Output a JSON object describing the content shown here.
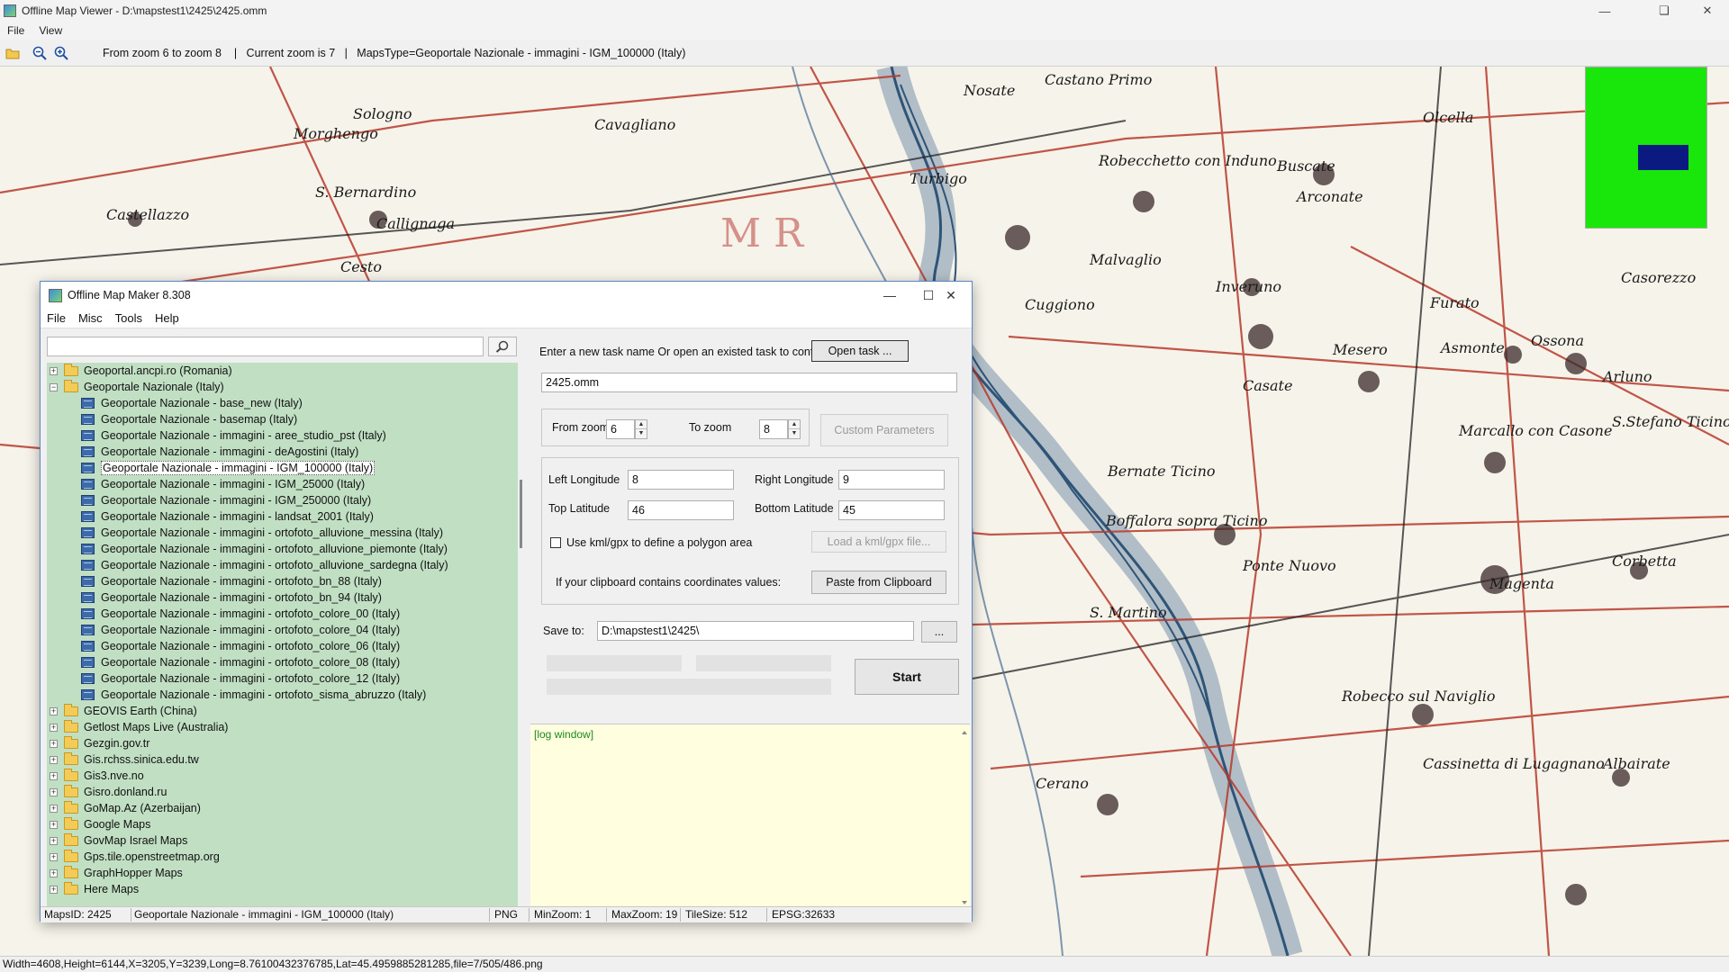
{
  "viewer": {
    "title": "Offline Map Viewer - D:\\mapstest1\\2425\\2425.omm",
    "menu": [
      "File",
      "View"
    ],
    "toolbar_info": "From zoom 6 to zoom 8    |   Current zoom is 7   |   MapsType=Geoportale Nazionale - immagini - IGM_100000 (Italy)",
    "status": "Width=4608,Height=6144,X=3205,Y=3239,Long=8.76100432376785,Lat=45.4959885281285,file=7/505/486.png",
    "overview_color": "#19e60a",
    "viewport_color": "#0b1a80"
  },
  "map_labels": [
    "Nosate",
    "Castano Primo",
    "Robecchetto con Induno",
    "Buscate",
    "Arconate",
    "Turbigo",
    "Cuggiono",
    "Inveruno",
    "Mesero",
    "Ossona",
    "Arluno",
    "Casorezzo",
    "Marcallo con Casone",
    "S.Stefano Ticino",
    "Bernate Ticino",
    "Boffalora sopra Ticino",
    "Ponte Nuovo",
    "Magenta",
    "Corbetta",
    "Robecco sul Naviglio",
    "Cassinetta di Lugagnano",
    "Albairate",
    "Cerano",
    "S. Martino",
    "Castellazzo",
    "Callignaga",
    "S. Bernardino",
    "Morghengo",
    "Sologno",
    "Cavagliano",
    "Cesto",
    "Olcella",
    "Malvaglio",
    "Furato",
    "Asmonte",
    "Casate",
    "Mesero"
  ],
  "dialog": {
    "title": "Offline Map Maker 8.308",
    "menu": [
      "File",
      "Misc",
      "Tools",
      "Help"
    ],
    "search_value": "",
    "tree": [
      {
        "type": "folder",
        "label": "Geoportal.ancpi.ro (Romania)",
        "expanded": false
      },
      {
        "type": "folder",
        "label": "Geoportale Nazionale (Italy)",
        "expanded": true
      },
      {
        "type": "map",
        "label": "Geoportale Nazionale - base_new (Italy)"
      },
      {
        "type": "map",
        "label": "Geoportale Nazionale - basemap (Italy)"
      },
      {
        "type": "map",
        "label": "Geoportale Nazionale - immagini - aree_studio_pst (Italy)"
      },
      {
        "type": "map",
        "label": "Geoportale Nazionale - immagini - deAgostini (Italy)"
      },
      {
        "type": "map",
        "label": "Geoportale Nazionale - immagini - IGM_100000 (Italy)",
        "selected": true
      },
      {
        "type": "map",
        "label": "Geoportale Nazionale - immagini - IGM_25000 (Italy)"
      },
      {
        "type": "map",
        "label": "Geoportale Nazionale - immagini - IGM_250000 (Italy)"
      },
      {
        "type": "map",
        "label": "Geoportale Nazionale - immagini - landsat_2001 (Italy)"
      },
      {
        "type": "map",
        "label": "Geoportale Nazionale - immagini - ortofoto_alluvione_messina (Italy)"
      },
      {
        "type": "map",
        "label": "Geoportale Nazionale - immagini - ortofoto_alluvione_piemonte (Italy)"
      },
      {
        "type": "map",
        "label": "Geoportale Nazionale - immagini - ortofoto_alluvione_sardegna (Italy)"
      },
      {
        "type": "map",
        "label": "Geoportale Nazionale - immagini - ortofoto_bn_88 (Italy)"
      },
      {
        "type": "map",
        "label": "Geoportale Nazionale - immagini - ortofoto_bn_94 (Italy)"
      },
      {
        "type": "map",
        "label": "Geoportale Nazionale - immagini - ortofoto_colore_00 (Italy)"
      },
      {
        "type": "map",
        "label": "Geoportale Nazionale - immagini - ortofoto_colore_04 (Italy)"
      },
      {
        "type": "map",
        "label": "Geoportale Nazionale - immagini - ortofoto_colore_06 (Italy)"
      },
      {
        "type": "map",
        "label": "Geoportale Nazionale - immagini - ortofoto_colore_08 (Italy)"
      },
      {
        "type": "map",
        "label": "Geoportale Nazionale - immagini - ortofoto_colore_12 (Italy)"
      },
      {
        "type": "map",
        "label": "Geoportale Nazionale - immagini - ortofoto_sisma_abruzzo (Italy)"
      },
      {
        "type": "folder",
        "label": "GEOVIS Earth (China)",
        "expanded": false
      },
      {
        "type": "folder",
        "label": "Getlost Maps Live (Australia)",
        "expanded": false
      },
      {
        "type": "folder",
        "label": "Gezgin.gov.tr",
        "expanded": false
      },
      {
        "type": "folder",
        "label": "Gis.rchss.sinica.edu.tw",
        "expanded": false
      },
      {
        "type": "folder",
        "label": "Gis3.nve.no",
        "expanded": false
      },
      {
        "type": "folder",
        "label": "Gisro.donland.ru",
        "expanded": false
      },
      {
        "type": "folder",
        "label": "GoMap.Az (Azerbaijan)",
        "expanded": false
      },
      {
        "type": "folder",
        "label": "Google Maps",
        "expanded": false
      },
      {
        "type": "folder",
        "label": "GovMap Israel Maps",
        "expanded": false
      },
      {
        "type": "folder",
        "label": "Gps.tile.openstreetmap.org",
        "expanded": false
      },
      {
        "type": "folder",
        "label": "GraphHopper Maps",
        "expanded": false
      },
      {
        "type": "folder",
        "label": "Here Maps",
        "expanded": false
      }
    ],
    "task_prompt": "Enter a new task name Or open an existed task to continue:",
    "open_task_label": "Open task ...",
    "task_name": "2425.omm",
    "from_zoom_label": "From zoom",
    "from_zoom": "6",
    "to_zoom_label": "To zoom",
    "to_zoom": "8",
    "custom_params_label": "Custom Parameters",
    "left_lon_label": "Left Longitude",
    "left_lon": "8",
    "right_lon_label": "Right Longitude",
    "right_lon": "9",
    "top_lat_label": "Top Latitude",
    "top_lat": "46",
    "bottom_lat_label": "Bottom Latitude",
    "bottom_lat": "45",
    "kml_label": "Use kml/gpx to define a polygon area",
    "load_kml_label": "Load a kml/gpx file...",
    "clipboard_prompt": "If your clipboard contains coordinates values:",
    "paste_label": "Paste from Clipboard",
    "save_to_label": "Save to:",
    "save_to": "D:\\mapstest1\\2425\\",
    "browse_label": "...",
    "start_label": "Start",
    "log_text": "[log window]",
    "status": {
      "maps_id": "MapsID: 2425",
      "maps_name": "Geoportale Nazionale - immagini - IGM_100000 (Italy)",
      "format": "PNG",
      "min_zoom": "MinZoom: 1",
      "max_zoom": "MaxZoom: 19",
      "tile_size": "TileSize: 512",
      "epsg": "EPSG:32633"
    }
  }
}
